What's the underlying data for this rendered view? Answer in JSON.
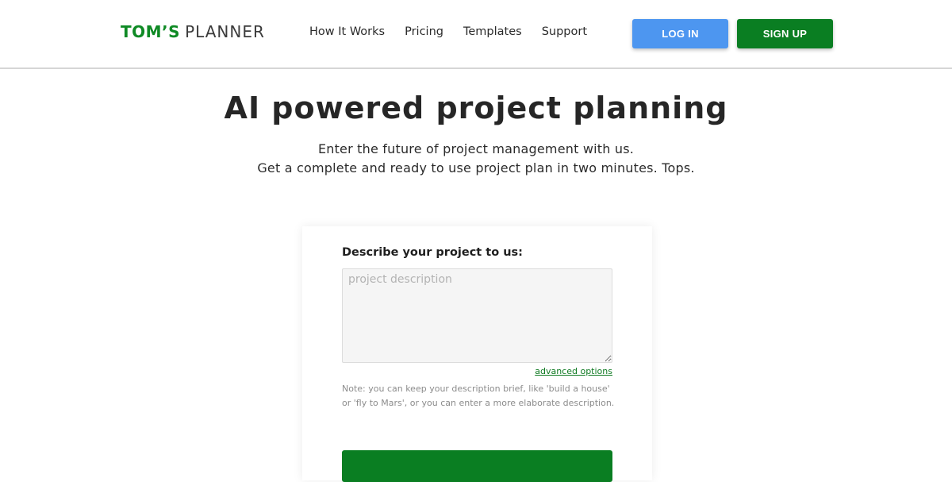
{
  "header": {
    "logo": {
      "part1": "TOM’S",
      "part2": "PLANNER"
    },
    "nav": [
      {
        "label": "How It Works"
      },
      {
        "label": "Pricing"
      },
      {
        "label": "Templates"
      },
      {
        "label": "Support"
      }
    ],
    "login_label": "LOG IN",
    "signup_label": "SIGN UP"
  },
  "hero": {
    "title": "AI powered project planning",
    "subtitle_line1": "Enter the future of project management with us.",
    "subtitle_line2": "Get a complete and ready to use project plan in two minutes. Tops."
  },
  "form": {
    "label": "Describe your project to us:",
    "textarea_placeholder": "project description",
    "textarea_value": "",
    "advanced_link": "advanced options",
    "note": "Note: you can keep your description brief, like 'build a house' or 'fly to Mars', or you can enter a more elaborate description.",
    "submit_label": ""
  },
  "colors": {
    "brand_green": "#0a7e22",
    "login_blue": "#4d96f0"
  }
}
